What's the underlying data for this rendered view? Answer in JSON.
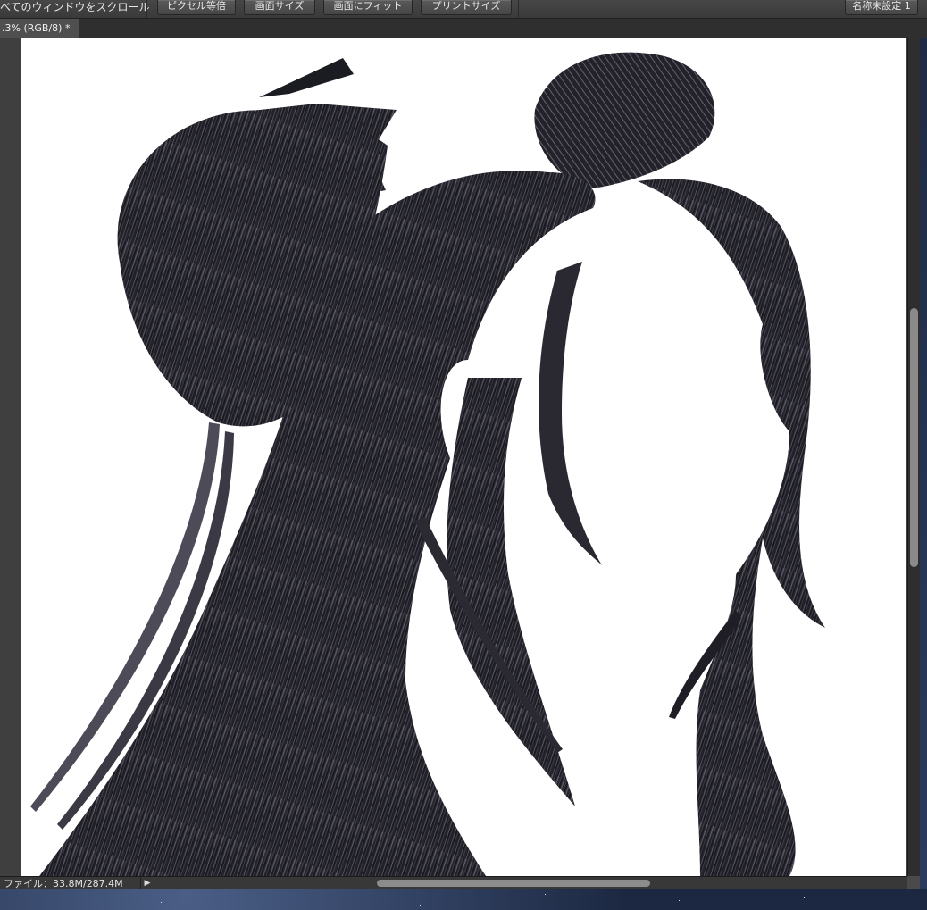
{
  "options_bar": {
    "scroll_all_label": "べてのウィンドウをスクロール",
    "buttons": {
      "actual_pixels": "ピクセル等倍",
      "fit_screen": "画面サイズ",
      "fill_screen": "画面にフィット",
      "print_size": "プリントサイズ"
    },
    "workspace": "名称未設定 1"
  },
  "document": {
    "tab_title": ".3% (RGB/8) *"
  },
  "status": {
    "file_info": "ファイル：33.8M/287.4M"
  },
  "colors": {
    "hair_dark": "#17171d",
    "hair_mid": "#3c3b46",
    "hair_highlight": "#9e9daa",
    "canvas": "#ffffff"
  }
}
